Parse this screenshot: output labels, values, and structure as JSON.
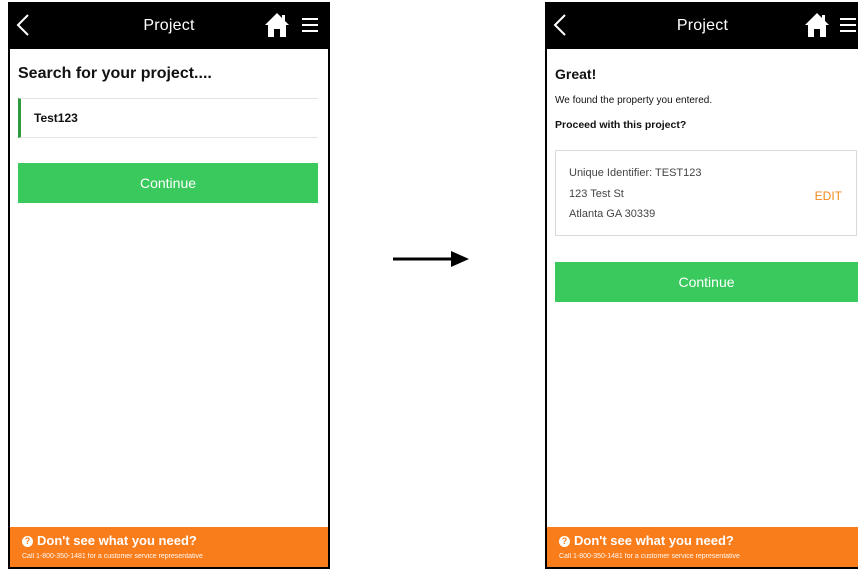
{
  "left_screen": {
    "topbar": {
      "title": "Project"
    },
    "heading": "Search for your project....",
    "search": {
      "value": "Test123"
    },
    "continue_label": "Continue",
    "footer": {
      "title": "Don't see what you need?",
      "subtitle": "Call 1-800-350-1481 for a customer service representative"
    }
  },
  "right_screen": {
    "topbar": {
      "title": "Project"
    },
    "great": "Great!",
    "found_text": "We found the property you entered.",
    "proceed_text": "Proceed with this project?",
    "property": {
      "identifier": "Unique Identifier: TEST123",
      "street": "123 Test St",
      "city": "Atlanta GA 30339",
      "edit_label": "EDIT"
    },
    "continue_label": "Continue",
    "footer": {
      "title": "Don't see what you need?",
      "subtitle": "Call 1-800-350-1481 for a customer service representative"
    }
  },
  "icons": {
    "back": "chevron-left-icon",
    "home": "home-icon",
    "menu": "hamburger-menu-icon",
    "help": "question-circle-icon",
    "flow": "arrow-right-icon"
  },
  "colors": {
    "topbar": "#000000",
    "continue_button": "#39c95c",
    "input_accent": "#2e9a3e",
    "footer": "#fa7d1c",
    "edit_link": "#f08a1c"
  }
}
